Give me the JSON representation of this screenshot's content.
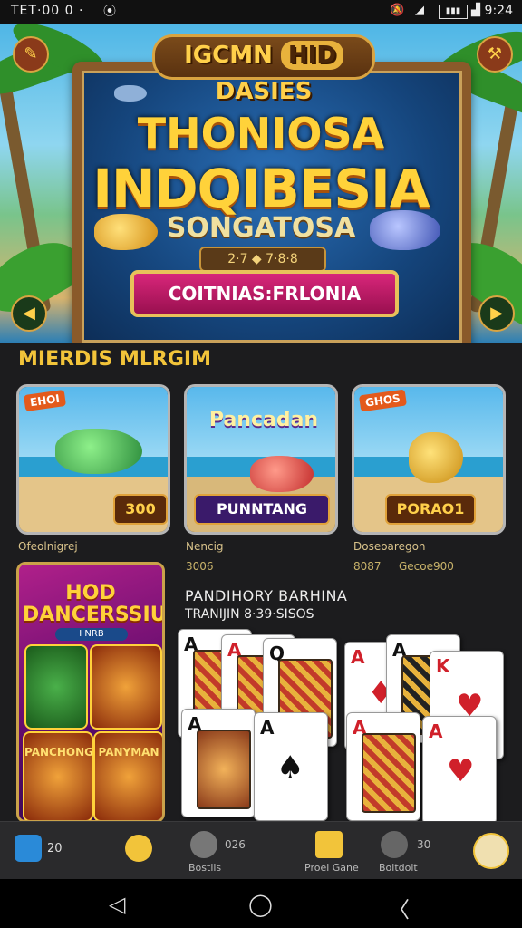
{
  "status_bar": {
    "left_text": "TET·00 0 ·",
    "right_text": "9:24"
  },
  "hero": {
    "badge_left": "IGCMN",
    "badge_mid": "HID",
    "badge_right": "DASIES",
    "title_line1": "THONIOSA",
    "title_line2": "INDQIBESIA",
    "title_line3": "SONGATOSA",
    "stats": "2·7 ◆ 7·8·8",
    "button_label": "COITNIAS:FRLONIA"
  },
  "section_title": "MIERDIS MLRGIM",
  "games": [
    {
      "tag": "EHOI",
      "banner": "300",
      "caption": "Ofeolnigrej"
    },
    {
      "tag": "Pancadan",
      "banner": "PUNNTANG",
      "caption": "Nencig"
    },
    {
      "tag": "GHOS",
      "banner": "PORAO1",
      "caption": "Doseoaregon"
    }
  ],
  "game_sub": {
    "left": "3006",
    "mid_a": "8087",
    "mid_b": "Gecoe900"
  },
  "poster": {
    "title": "HOD DANCERSSIUR",
    "sub": "I NRB",
    "tile1": "PANCHONG",
    "tile2": "PANYMAN"
  },
  "cards_section": {
    "title": "PANDIHORY BARHINA",
    "subtitle": "TRANIJIN 8·39·SISOS"
  },
  "cards": [
    "A",
    "A",
    "Q",
    "A",
    "A",
    "K",
    "A",
    "A",
    "A",
    "A"
  ],
  "nav": {
    "items": [
      {
        "label": "",
        "value": "20",
        "icon": "wallet-icon"
      },
      {
        "label": "",
        "value": "",
        "icon": "coin-icon"
      },
      {
        "label": "Bostlis",
        "value": "026",
        "icon": "profile-icon"
      },
      {
        "label": "Proei Gane",
        "value": "",
        "icon": "game-icon"
      },
      {
        "label": "Boltdolt",
        "value": "30",
        "icon": "settings-icon"
      },
      {
        "label": "",
        "value": "",
        "icon": "mascot-icon"
      }
    ]
  },
  "colors": {
    "accent_gold": "#f2c43a",
    "brand_magenta": "#d8267a",
    "bg": "#1c1c1e"
  }
}
